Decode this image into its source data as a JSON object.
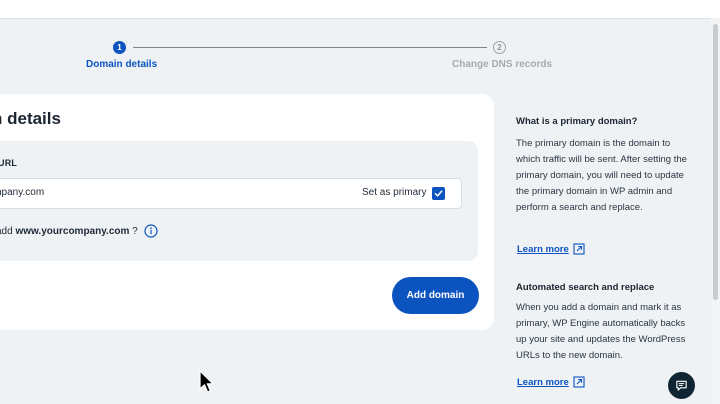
{
  "stepper": {
    "steps": [
      {
        "number": "1",
        "label": "Domain details",
        "active": true
      },
      {
        "number": "2",
        "label": "Change DNS records",
        "active": false
      }
    ]
  },
  "card": {
    "title": "n details",
    "field_label": "URL",
    "domain_value": "npany.com",
    "set_primary_label": "Set as primary",
    "set_primary_checked": true,
    "hint_prefix": "add ",
    "hint_domain": "www.yourcompany.com",
    "hint_suffix": " ?",
    "add_button_label": "Add domain"
  },
  "sidebar": {
    "sections": [
      {
        "heading": "What is a primary domain?",
        "body": "The primary domain is the domain to which traffic will be sent. After setting the primary domain, you will need to update the primary domain in WP admin and perform a search and replace.",
        "link_label": "Learn more"
      },
      {
        "heading": "Automated search and replace",
        "body": "When you add a domain and mark it as primary, WP Engine automatically backs up your site and updates the WordPress URLs to the new domain.",
        "link_label": "Learn more"
      }
    ]
  },
  "colors": {
    "accent": "#0b53bf",
    "background": "#eef2f5",
    "chat_button": "#0f2534"
  },
  "icons": [
    "check-icon",
    "info-icon",
    "external-link-icon",
    "chat-icon",
    "mouse-cursor-icon"
  ]
}
